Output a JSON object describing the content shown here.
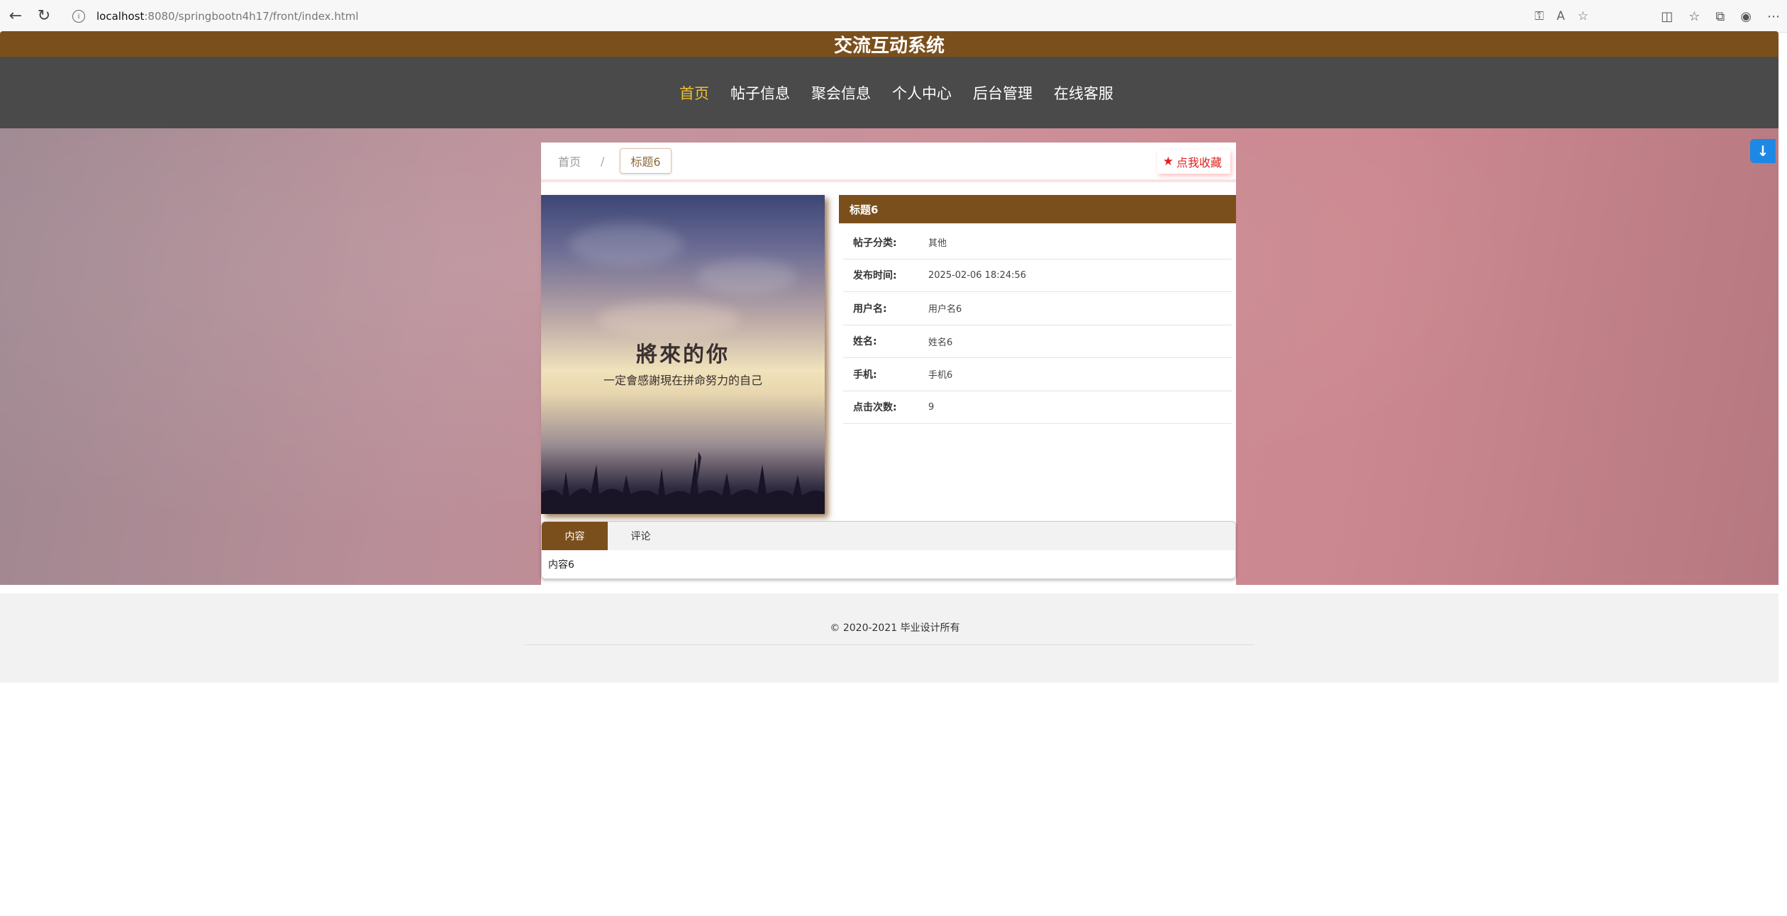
{
  "browser": {
    "url_host": "localhost",
    "url_path": ":8080/springbootn4h17/front/index.html"
  },
  "site": {
    "title": "交流互动系统"
  },
  "nav": {
    "items": [
      {
        "label": "首页",
        "active": true
      },
      {
        "label": "帖子信息",
        "active": false
      },
      {
        "label": "聚会信息",
        "active": false
      },
      {
        "label": "个人中心",
        "active": false
      },
      {
        "label": "后台管理",
        "active": false
      },
      {
        "label": "在线客服",
        "active": false
      }
    ]
  },
  "breadcrumb": {
    "home": "首页",
    "separator": "/",
    "current": "标题6"
  },
  "favorite": {
    "label": "点我收藏",
    "icon": "star-icon"
  },
  "cover_image": {
    "title": "將來的你",
    "subtitle": "一定會感謝現在拼命努力的自己"
  },
  "detail": {
    "title": "标题6",
    "rows": [
      {
        "label": "帖子分类:",
        "value": "其他"
      },
      {
        "label": "发布时间:",
        "value": "2025-02-06 18:24:56"
      },
      {
        "label": "用户名:",
        "value": "用户名6"
      },
      {
        "label": "姓名:",
        "value": "姓名6"
      },
      {
        "label": "手机:",
        "value": "手机6"
      },
      {
        "label": "点击次数:",
        "value": "9"
      }
    ]
  },
  "tabs": {
    "items": [
      {
        "label": "内容",
        "active": true
      },
      {
        "label": "评论",
        "active": false
      }
    ],
    "content": "内容6"
  },
  "footer": {
    "copyright": "© 2020-2021 毕业设计所有"
  },
  "colors": {
    "brand_brown": "#7b4f1c",
    "nav_bg": "#4a4a4a",
    "nav_active": "#f0c030",
    "favorite_red": "#e02020",
    "float_blue": "#1e88e5"
  }
}
